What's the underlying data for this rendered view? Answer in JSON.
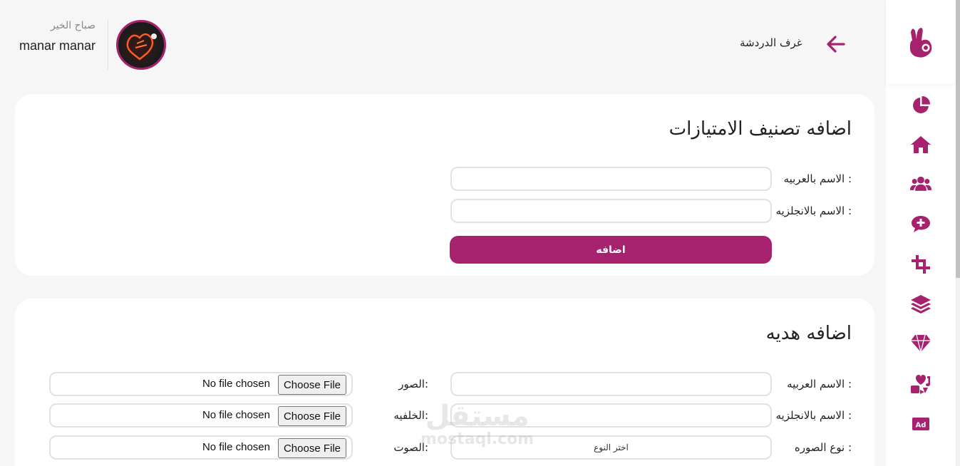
{
  "header": {
    "greeting": "صباح الخير",
    "user_name": "manar manar",
    "chat_rooms_label": "غرف الدردشة"
  },
  "colors": {
    "accent": "#a6226f",
    "background": "#f6f6f6",
    "card": "#ffffff",
    "input_border": "#e2e2e2"
  },
  "sidebar": {
    "logo_icon": "hand-ok-logo-icon",
    "items": [
      {
        "icon": "pie-chart-icon"
      },
      {
        "icon": "home-icon"
      },
      {
        "icon": "users-icon"
      },
      {
        "icon": "chat-plus-icon"
      },
      {
        "icon": "crop-icon"
      },
      {
        "icon": "layers-icon"
      },
      {
        "icon": "diamond-icon"
      },
      {
        "icon": "heart-music-icon"
      },
      {
        "icon": "ad-icon"
      }
    ]
  },
  "privilege_form": {
    "title": "اضافه تصنيف الامتيازات",
    "name_ar_label": "الاسم بالعربيه :",
    "name_en_label": "الاسم بالانجلزيه :",
    "name_ar_value": "",
    "name_en_value": "",
    "submit_label": "اضافه"
  },
  "gift_form": {
    "title": "اضافه هديه",
    "name_ar_label": "الاسم العربيه :",
    "name_en_label": "الاسم بالانجلزيه :",
    "image_type_label": "نوع الصوره :",
    "image_type_value": "اختر النوع",
    "images_label": "الصور:",
    "background_label": "الخلفيه:",
    "sound_label": "الصوت:",
    "choose_file_label": "Choose File",
    "no_file_label": "No file chosen"
  },
  "watermark": {
    "logo_text": "مستقل",
    "domain": "mostaql.com"
  }
}
